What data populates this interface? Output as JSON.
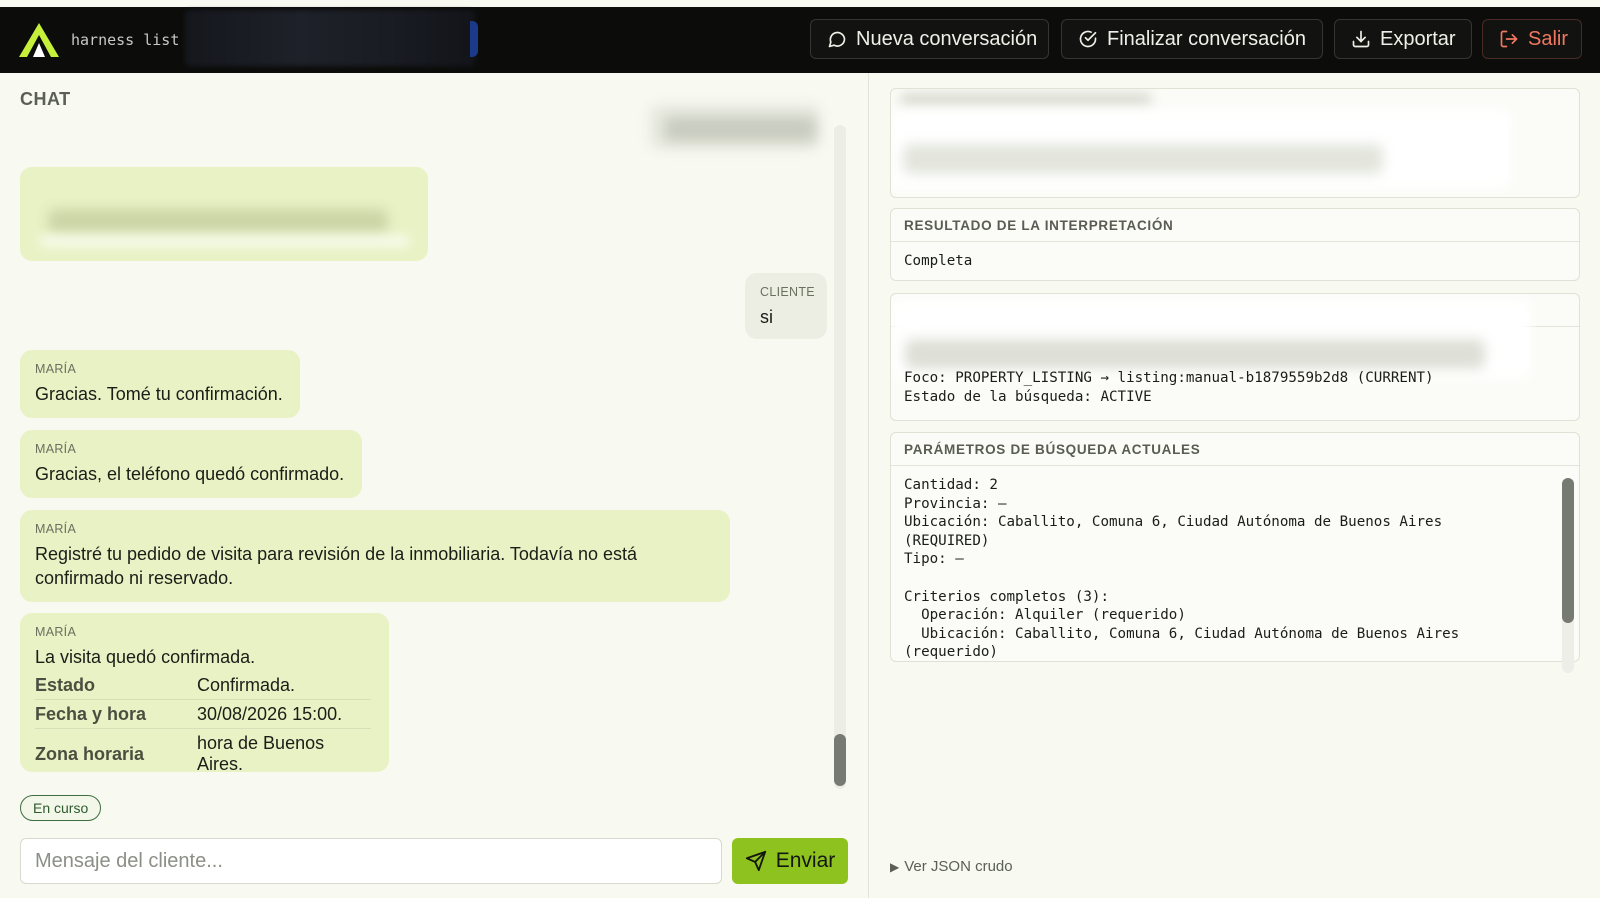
{
  "header": {
    "app_name": "harness list",
    "buttons": {
      "new_conversation": "Nueva conversación",
      "finish_conversation": "Finalizar conversación",
      "export": "Exportar",
      "logout": "Salir"
    },
    "accent": "#c6f03a"
  },
  "chat": {
    "title": "CHAT",
    "messages": [
      {
        "sender": "CLIENTE",
        "text": "si"
      },
      {
        "sender": "MARÍA",
        "text": "Gracias. Tomé tu confirmación."
      },
      {
        "sender": "MARÍA",
        "text": "Gracias, el teléfono quedó confirmado."
      },
      {
        "sender": "MARÍA",
        "text": "Registré tu pedido de visita para revisión de la inmobiliaria. Todavía no está confirmado ni reservado."
      },
      {
        "sender": "MARÍA",
        "text": "La visita quedó confirmada.",
        "details": [
          {
            "key": "Estado",
            "value": "Confirmada."
          },
          {
            "key": "Fecha y hora",
            "value": "30/08/2026 15:00."
          },
          {
            "key": "Zona horaria",
            "value": "hora de Buenos Aires."
          }
        ]
      }
    ],
    "status_badge": "En curso",
    "input": {
      "placeholder": "Mensaje del cliente...",
      "value": ""
    },
    "send_label": "Enviar",
    "send_color": "#8ec21e"
  },
  "panels": {
    "interpretation": {
      "title": "RESULTADO DE LA INTERPRETACIÓN",
      "body": "Completa"
    },
    "context": {
      "lines": [
        "Foco: PROPERTY_LISTING → listing:manual-b1879559b2d8 (CURRENT)",
        "Estado de la búsqueda: ACTIVE"
      ]
    },
    "search_params": {
      "title": "PARÁMETROS DE BÚSQUEDA ACTUALES",
      "lines": [
        "Cantidad: 2",
        "Provincia: —",
        "Ubicación: Caballito, Comuna 6, Ciudad Autónoma de Buenos Aires",
        "(REQUIRED)",
        "Tipo: —",
        "",
        "Criterios completos (3):",
        "  Operación: Alquiler (requerido)",
        "  Ubicación: Caballito, Comuna 6, Ciudad Autónoma de Buenos Aires",
        "(requerido)"
      ]
    },
    "raw_json_toggle": "Ver JSON crudo"
  }
}
